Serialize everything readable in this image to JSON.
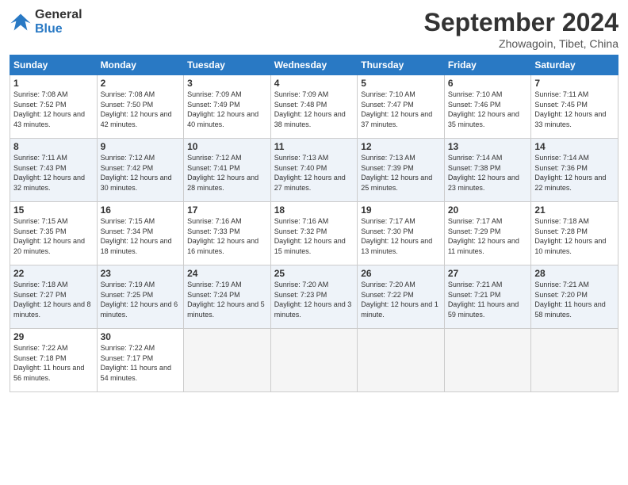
{
  "header": {
    "logo_line1": "General",
    "logo_line2": "Blue",
    "month": "September 2024",
    "location": "Zhowagoin, Tibet, China"
  },
  "weekdays": [
    "Sunday",
    "Monday",
    "Tuesday",
    "Wednesday",
    "Thursday",
    "Friday",
    "Saturday"
  ],
  "weeks": [
    [
      {
        "day": "1",
        "rise": "7:08 AM",
        "set": "7:52 PM",
        "daylight": "12 hours and 43 minutes."
      },
      {
        "day": "2",
        "rise": "7:08 AM",
        "set": "7:50 PM",
        "daylight": "12 hours and 42 minutes."
      },
      {
        "day": "3",
        "rise": "7:09 AM",
        "set": "7:49 PM",
        "daylight": "12 hours and 40 minutes."
      },
      {
        "day": "4",
        "rise": "7:09 AM",
        "set": "7:48 PM",
        "daylight": "12 hours and 38 minutes."
      },
      {
        "day": "5",
        "rise": "7:10 AM",
        "set": "7:47 PM",
        "daylight": "12 hours and 37 minutes."
      },
      {
        "day": "6",
        "rise": "7:10 AM",
        "set": "7:46 PM",
        "daylight": "12 hours and 35 minutes."
      },
      {
        "day": "7",
        "rise": "7:11 AM",
        "set": "7:45 PM",
        "daylight": "12 hours and 33 minutes."
      }
    ],
    [
      {
        "day": "8",
        "rise": "7:11 AM",
        "set": "7:43 PM",
        "daylight": "12 hours and 32 minutes."
      },
      {
        "day": "9",
        "rise": "7:12 AM",
        "set": "7:42 PM",
        "daylight": "12 hours and 30 minutes."
      },
      {
        "day": "10",
        "rise": "7:12 AM",
        "set": "7:41 PM",
        "daylight": "12 hours and 28 minutes."
      },
      {
        "day": "11",
        "rise": "7:13 AM",
        "set": "7:40 PM",
        "daylight": "12 hours and 27 minutes."
      },
      {
        "day": "12",
        "rise": "7:13 AM",
        "set": "7:39 PM",
        "daylight": "12 hours and 25 minutes."
      },
      {
        "day": "13",
        "rise": "7:14 AM",
        "set": "7:38 PM",
        "daylight": "12 hours and 23 minutes."
      },
      {
        "day": "14",
        "rise": "7:14 AM",
        "set": "7:36 PM",
        "daylight": "12 hours and 22 minutes."
      }
    ],
    [
      {
        "day": "15",
        "rise": "7:15 AM",
        "set": "7:35 PM",
        "daylight": "12 hours and 20 minutes."
      },
      {
        "day": "16",
        "rise": "7:15 AM",
        "set": "7:34 PM",
        "daylight": "12 hours and 18 minutes."
      },
      {
        "day": "17",
        "rise": "7:16 AM",
        "set": "7:33 PM",
        "daylight": "12 hours and 16 minutes."
      },
      {
        "day": "18",
        "rise": "7:16 AM",
        "set": "7:32 PM",
        "daylight": "12 hours and 15 minutes."
      },
      {
        "day": "19",
        "rise": "7:17 AM",
        "set": "7:30 PM",
        "daylight": "12 hours and 13 minutes."
      },
      {
        "day": "20",
        "rise": "7:17 AM",
        "set": "7:29 PM",
        "daylight": "12 hours and 11 minutes."
      },
      {
        "day": "21",
        "rise": "7:18 AM",
        "set": "7:28 PM",
        "daylight": "12 hours and 10 minutes."
      }
    ],
    [
      {
        "day": "22",
        "rise": "7:18 AM",
        "set": "7:27 PM",
        "daylight": "12 hours and 8 minutes."
      },
      {
        "day": "23",
        "rise": "7:19 AM",
        "set": "7:25 PM",
        "daylight": "12 hours and 6 minutes."
      },
      {
        "day": "24",
        "rise": "7:19 AM",
        "set": "7:24 PM",
        "daylight": "12 hours and 5 minutes."
      },
      {
        "day": "25",
        "rise": "7:20 AM",
        "set": "7:23 PM",
        "daylight": "12 hours and 3 minutes."
      },
      {
        "day": "26",
        "rise": "7:20 AM",
        "set": "7:22 PM",
        "daylight": "12 hours and 1 minute."
      },
      {
        "day": "27",
        "rise": "7:21 AM",
        "set": "7:21 PM",
        "daylight": "11 hours and 59 minutes."
      },
      {
        "day": "28",
        "rise": "7:21 AM",
        "set": "7:20 PM",
        "daylight": "11 hours and 58 minutes."
      }
    ],
    [
      {
        "day": "29",
        "rise": "7:22 AM",
        "set": "7:18 PM",
        "daylight": "11 hours and 56 minutes."
      },
      {
        "day": "30",
        "rise": "7:22 AM",
        "set": "7:17 PM",
        "daylight": "11 hours and 54 minutes."
      },
      null,
      null,
      null,
      null,
      null
    ]
  ]
}
